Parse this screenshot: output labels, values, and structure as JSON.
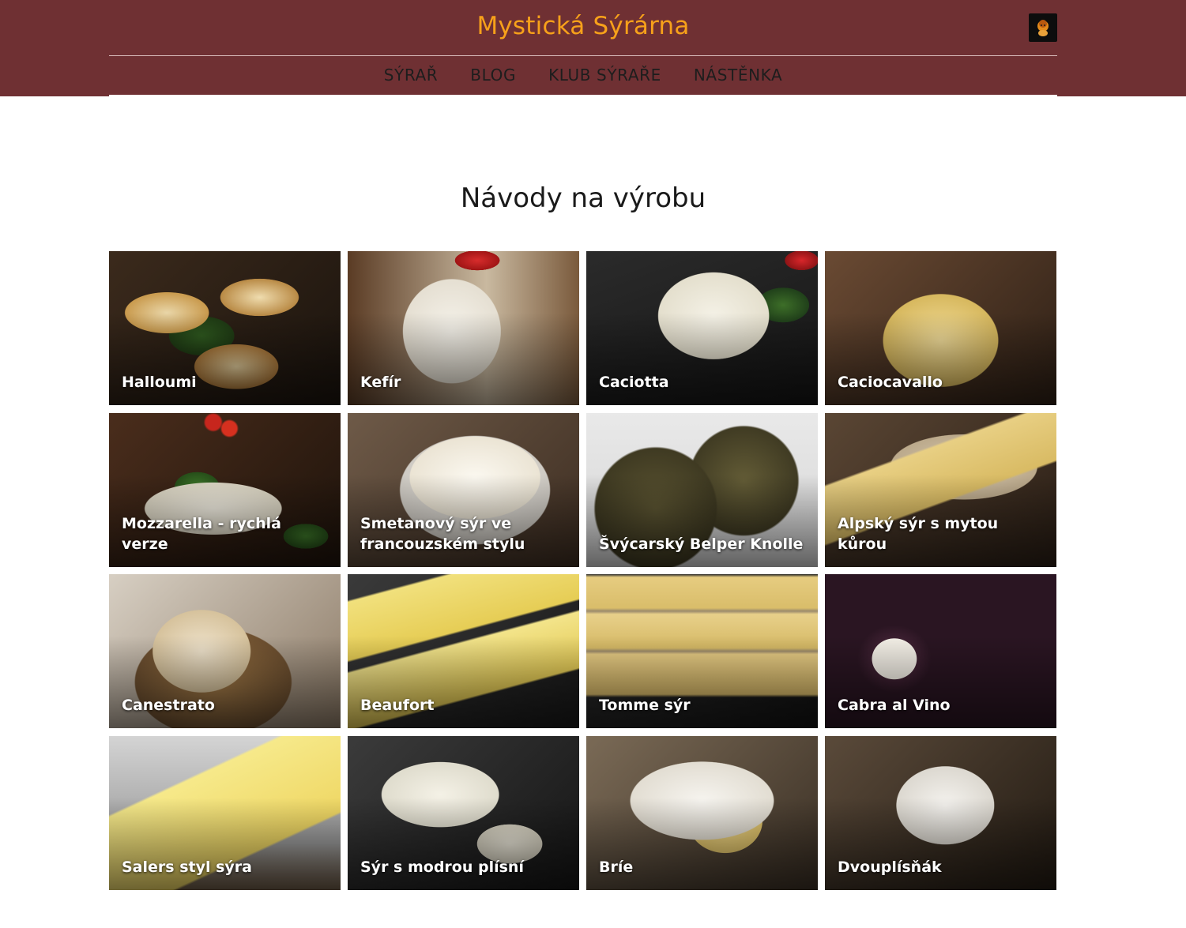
{
  "header": {
    "site_title": "Mystická Sýrárna",
    "nav": [
      {
        "label": "SÝRAŘ"
      },
      {
        "label": "BLOG"
      },
      {
        "label": "KLUB SÝRAŘE"
      },
      {
        "label": "NÁSTĚNKA"
      }
    ]
  },
  "main": {
    "title": "Návody na výrobu",
    "cards": [
      {
        "label": "Halloumi",
        "image": "halloumi-photo"
      },
      {
        "label": "Kefír",
        "image": "kefir-photo"
      },
      {
        "label": "Caciotta",
        "image": "caciotta-photo"
      },
      {
        "label": "Caciocavallo",
        "image": "caciocavallo-photo"
      },
      {
        "label": "Mozzarella - rychlá verze",
        "image": "mozzarella-photo"
      },
      {
        "label": "Smetanový sýr ve francouzském stylu",
        "image": "smetanovy-syr-photo"
      },
      {
        "label": "Švýcarský Belper Knolle",
        "image": "belper-knolle-photo"
      },
      {
        "label": "Alpský sýr s mytou kůrou",
        "image": "alpsky-syr-photo"
      },
      {
        "label": "Canestrato",
        "image": "canestrato-photo"
      },
      {
        "label": "Beaufort",
        "image": "beaufort-photo"
      },
      {
        "label": "Tomme sýr",
        "image": "tomme-photo"
      },
      {
        "label": "Cabra al Vino",
        "image": "cabra-al-vino-photo"
      },
      {
        "label": "Salers styl sýra",
        "image": "salers-photo"
      },
      {
        "label": "Sýr s modrou plísní",
        "image": "modra-plisen-photo"
      },
      {
        "label": "Bríe",
        "image": "brie-photo"
      },
      {
        "label": "Dvouplísňák",
        "image": "dvouplisnak-photo"
      }
    ]
  },
  "colors": {
    "header_bg": "#6f3033",
    "title_accent": "#f7a11a",
    "nav_text": "#1d1d1d"
  }
}
